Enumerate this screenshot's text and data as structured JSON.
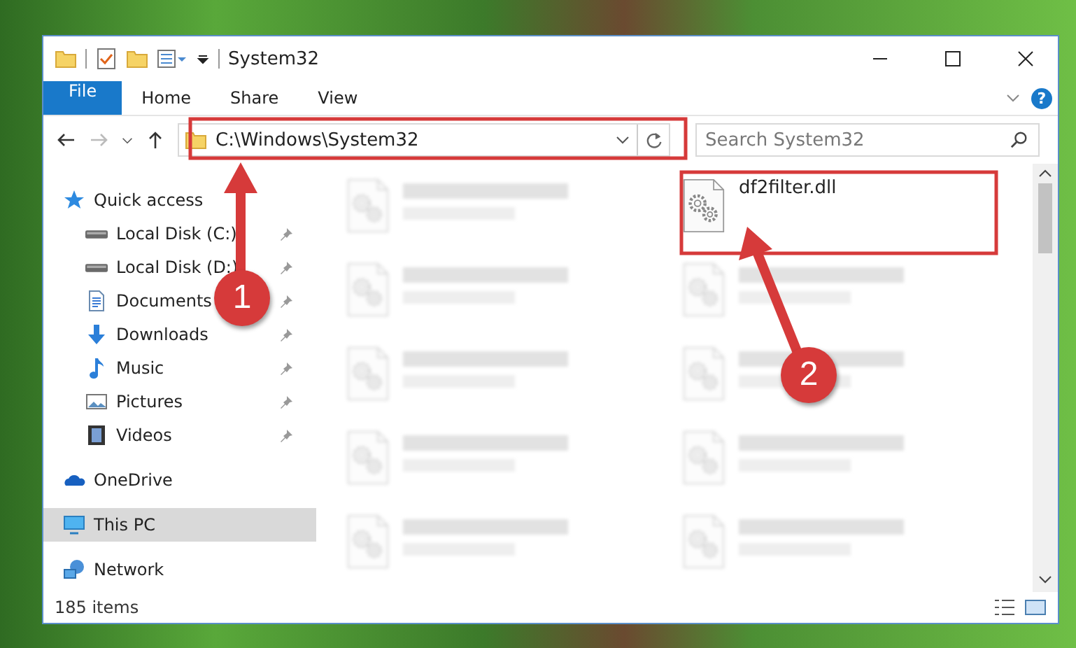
{
  "window": {
    "title": "System32"
  },
  "ribbon_tabs": [
    {
      "label": "File",
      "kind": "file"
    },
    {
      "label": "Home",
      "kind": "tab"
    },
    {
      "label": "Share",
      "kind": "tab"
    },
    {
      "label": "View",
      "kind": "tab"
    }
  ],
  "help": "?",
  "address": {
    "path": "C:\\Windows\\System32"
  },
  "search": {
    "placeholder": "Search System32"
  },
  "nav": [
    {
      "label": "Quick access",
      "kind": "star",
      "selected": false,
      "children": [
        {
          "label": "Local Disk (C:)",
          "kind": "drive",
          "pinned": true
        },
        {
          "label": "Local Disk (D:)",
          "kind": "drive",
          "pinned": true
        },
        {
          "label": "Documents",
          "kind": "document",
          "pinned": true
        },
        {
          "label": "Downloads",
          "kind": "download",
          "pinned": true
        },
        {
          "label": "Music",
          "kind": "music",
          "pinned": true
        },
        {
          "label": "Pictures",
          "kind": "picture",
          "pinned": true
        },
        {
          "label": "Videos",
          "kind": "video",
          "pinned": true
        }
      ]
    },
    {
      "label": "OneDrive",
      "kind": "cloud",
      "selected": false
    },
    {
      "label": "This PC",
      "kind": "pc",
      "selected": true
    },
    {
      "label": "Network",
      "kind": "network",
      "selected": false
    }
  ],
  "files": [
    {
      "blurred": true
    },
    {
      "name": "df2filter.dll",
      "blurred": false
    },
    {
      "blurred": true
    },
    {
      "blurred": true
    },
    {
      "blurred": true
    },
    {
      "blurred": true
    },
    {
      "blurred": true
    },
    {
      "blurred": true
    },
    {
      "blurred": true
    },
    {
      "blurred": true
    }
  ],
  "status_bar": {
    "count": "185 items"
  },
  "annotations": [
    {
      "number": "1"
    },
    {
      "number": "2"
    }
  ]
}
